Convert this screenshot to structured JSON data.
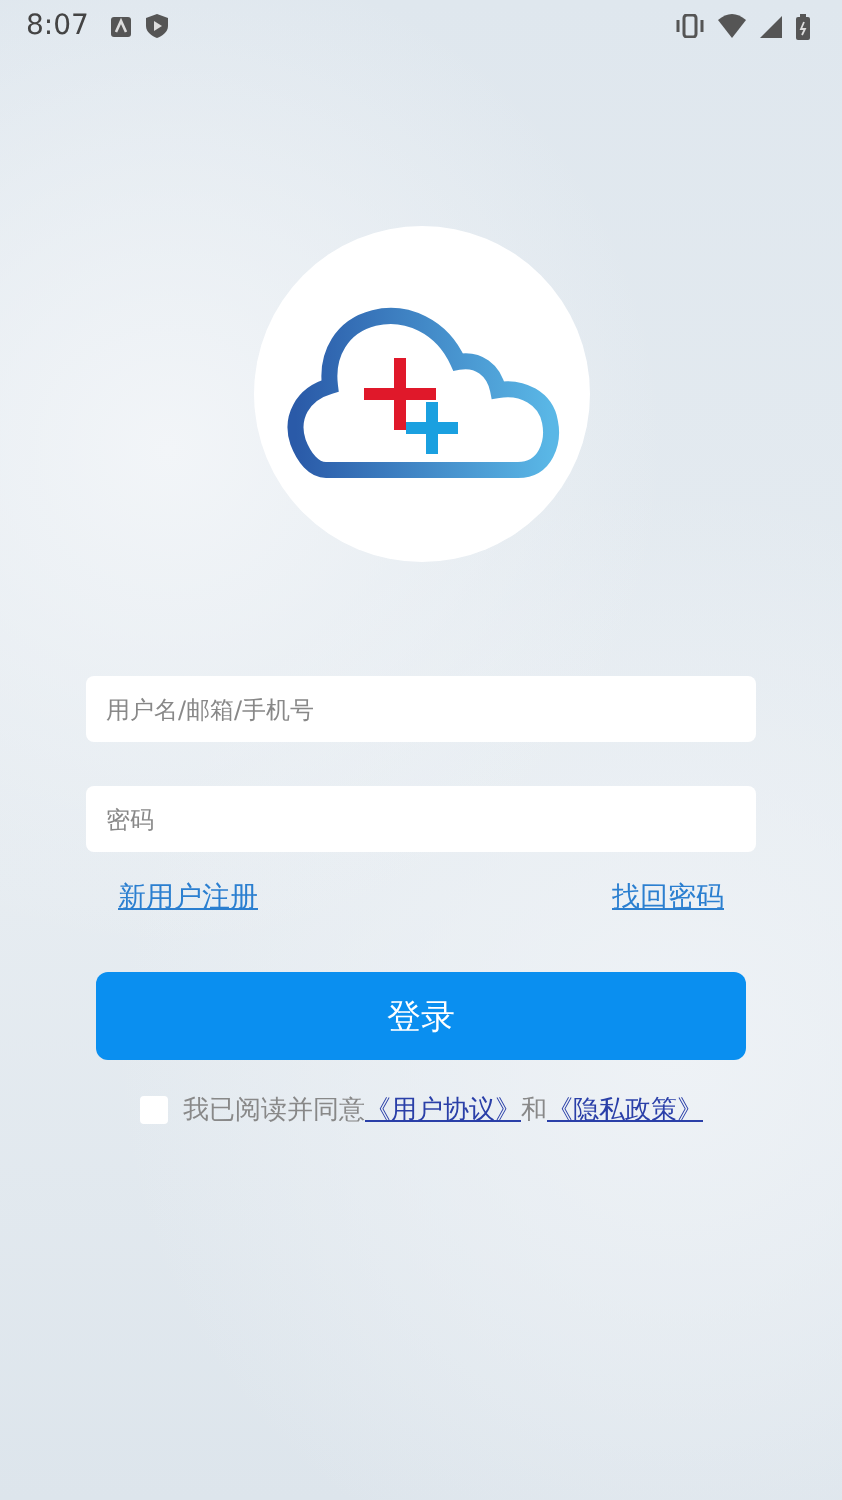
{
  "status_bar": {
    "time": "8:07"
  },
  "form": {
    "username": {
      "placeholder": "用户名/邮箱/手机号"
    },
    "password": {
      "placeholder": "密码"
    }
  },
  "links": {
    "register": "新用户注册",
    "recover": "找回密码"
  },
  "login_button": "登录",
  "agreement": {
    "checked": false,
    "text": "我已阅读并同意",
    "link_1": "《用户协议》",
    "joiner": "和",
    "link_2": "《隐私政策》"
  }
}
